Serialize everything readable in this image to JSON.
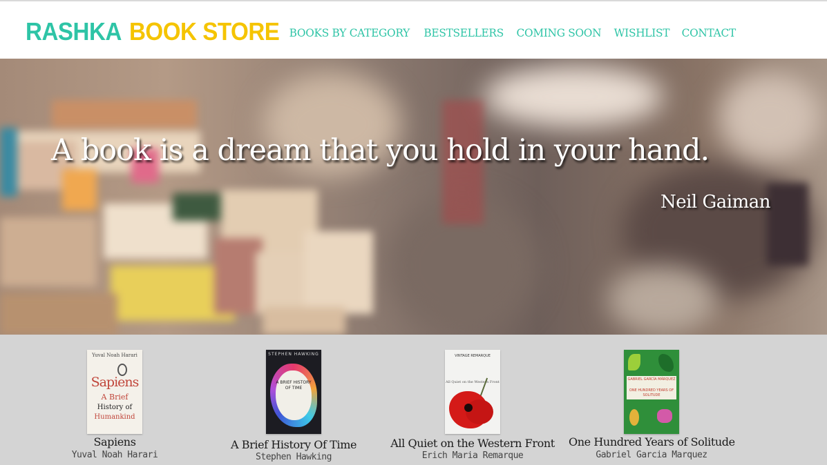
{
  "header": {
    "logo_part1": "RASHKA",
    "logo_part2": "BOOK STORE",
    "nav": [
      {
        "label": "BOOKS BY CATEGORY"
      },
      {
        "label": "BESTSELLERS"
      },
      {
        "label": "COMING SOON"
      },
      {
        "label": "WISHLIST"
      },
      {
        "label": "CONTACT"
      }
    ]
  },
  "hero": {
    "quote": "A book is a dream that you hold in your hand.",
    "author": "Neil Gaiman"
  },
  "books": [
    {
      "title": "Sapiens",
      "author": "Yuval Noah Harari",
      "cover": {
        "top": "Yuval Noah Harari",
        "title": "Sapiens",
        "sub1": "A Brief",
        "sub2": "History of",
        "sub3": "Humankind"
      }
    },
    {
      "title": "A Brief History Of Time",
      "author": "Stephen Hawking",
      "cover": {
        "top": "STEPHEN HAWKING",
        "title": "A BRIEF HISTORY OF TIME"
      }
    },
    {
      "title": "All Quiet on the Western Front",
      "author": "Erich Maria Remarque",
      "cover": {
        "top": "VINTAGE REMARQUE",
        "title": "All Quiet on the Western Front"
      }
    },
    {
      "title": "One Hundred Years of Solitude",
      "author": "Gabriel Garcia Marquez",
      "cover": {
        "top": "GABRIEL GARCÍA MÁRQUEZ",
        "title": "ONE HUNDRED YEARS OF SOLITUDE"
      }
    }
  ],
  "colors": {
    "brand_teal": "#2ec4a6",
    "brand_yellow": "#f5c400",
    "strip_bg": "#d4d4d4",
    "price_red": "#e0463c"
  }
}
